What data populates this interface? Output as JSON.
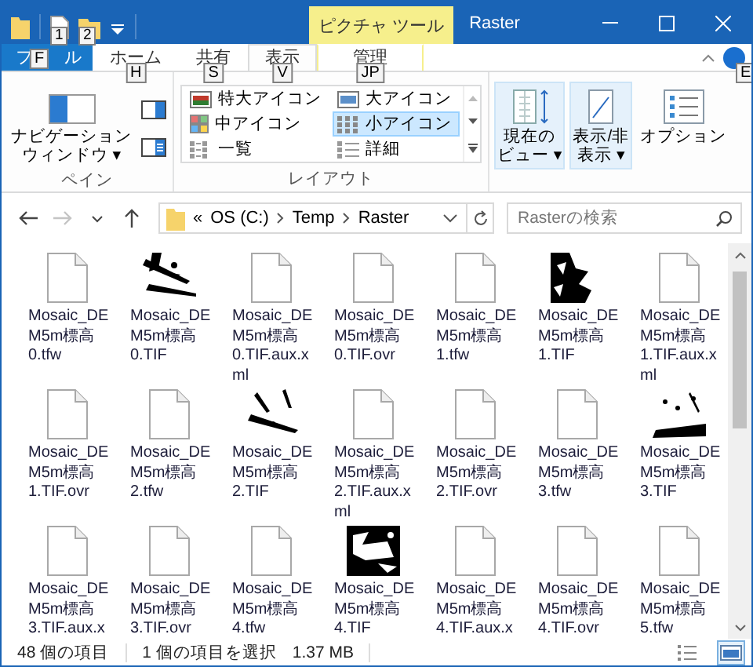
{
  "quick_access": {
    "keytips": [
      "1",
      "2"
    ]
  },
  "context_tab": {
    "label": "ピクチャ ツール"
  },
  "window": {
    "title": "Raster"
  },
  "tabs": [
    {
      "kind": "file",
      "label_start": "フ",
      "label_end": "ル",
      "keytip": "F",
      "selected": false
    },
    {
      "kind": "normal",
      "label": "ホーム",
      "keytip": "H",
      "selected": false
    },
    {
      "kind": "normal",
      "label": "共有",
      "keytip": "S",
      "selected": false
    },
    {
      "kind": "normal",
      "label": "表示",
      "keytip": "V",
      "selected": true
    },
    {
      "kind": "context",
      "label": "管理",
      "keytip": "JP",
      "selected": false
    }
  ],
  "help_keytip": "E",
  "ribbon": {
    "pane_group": {
      "label": "ペイン",
      "nav_pane_lines": [
        "ナビゲーション",
        "ウィンドウ ▾"
      ]
    },
    "layout_group": {
      "label": "レイアウト",
      "options": [
        {
          "kind": "xlarge",
          "label": "特大アイコン",
          "selected": false
        },
        {
          "kind": "large",
          "label": "大アイコン",
          "selected": false
        },
        {
          "kind": "medium",
          "label": "中アイコン",
          "selected": false
        },
        {
          "kind": "small",
          "label": "小アイコン",
          "selected": true
        },
        {
          "kind": "list",
          "label": "一覧",
          "selected": false
        },
        {
          "kind": "details",
          "label": "詳細",
          "selected": false
        }
      ]
    },
    "view_buttons": [
      {
        "kind": "current_view",
        "lines": [
          "現在の",
          "ビュー ▾"
        ],
        "highlighted": true
      },
      {
        "kind": "show_hide",
        "lines": [
          "表示/非",
          "表示 ▾"
        ],
        "highlighted": true
      },
      {
        "kind": "options",
        "lines": [
          "オプション"
        ],
        "highlighted": false
      }
    ]
  },
  "nav_buttons": [
    {
      "kind": "back",
      "disabled": false
    },
    {
      "kind": "forward",
      "disabled": true
    },
    {
      "kind": "recent",
      "disabled": false
    },
    {
      "kind": "up",
      "disabled": false
    }
  ],
  "address": {
    "overflow_mark": "«",
    "crumbs": [
      "OS (C:)",
      "Temp",
      "Raster"
    ]
  },
  "search": {
    "placeholder": "Rasterの検索"
  },
  "files": [
    {
      "kind": "document",
      "name_lines": [
        "Mosaic_DE",
        "M5m標高",
        "0.tfw"
      ]
    },
    {
      "kind": "picture",
      "name_lines": [
        "Mosaic_DE",
        "M5m標高",
        "0.TIF"
      ]
    },
    {
      "kind": "document",
      "name_lines": [
        "Mosaic_DE",
        "M5m標高",
        "0.TIF.aux.x",
        "ml"
      ]
    },
    {
      "kind": "document",
      "name_lines": [
        "Mosaic_DE",
        "M5m標高",
        "0.TIF.ovr"
      ]
    },
    {
      "kind": "document",
      "name_lines": [
        "Mosaic_DE",
        "M5m標高",
        "1.tfw"
      ]
    },
    {
      "kind": "picture",
      "name_lines": [
        "Mosaic_DE",
        "M5m標高",
        "1.TIF"
      ]
    },
    {
      "kind": "document",
      "name_lines": [
        "Mosaic_DE",
        "M5m標高",
        "1.TIF.aux.x",
        "ml"
      ]
    },
    {
      "kind": "document",
      "name_lines": [
        "Mosaic_DE",
        "M5m標高",
        "1.TIF.ovr"
      ]
    },
    {
      "kind": "document",
      "name_lines": [
        "Mosaic_DE",
        "M5m標高",
        "2.tfw"
      ]
    },
    {
      "kind": "picture",
      "name_lines": [
        "Mosaic_DE",
        "M5m標高",
        "2.TIF"
      ]
    },
    {
      "kind": "document",
      "name_lines": [
        "Mosaic_DE",
        "M5m標高",
        "2.TIF.aux.x",
        "ml"
      ]
    },
    {
      "kind": "document",
      "name_lines": [
        "Mosaic_DE",
        "M5m標高",
        "2.TIF.ovr"
      ]
    },
    {
      "kind": "document",
      "name_lines": [
        "Mosaic_DE",
        "M5m標高",
        "3.tfw"
      ]
    },
    {
      "kind": "picture",
      "name_lines": [
        "Mosaic_DE",
        "M5m標高",
        "3.TIF"
      ]
    },
    {
      "kind": "document",
      "name_lines": [
        "Mosaic_DE",
        "M5m標高",
        "3.TIF.aux.x"
      ]
    },
    {
      "kind": "document",
      "name_lines": [
        "Mosaic_DE",
        "M5m標高",
        "3.TIF.ovr"
      ]
    },
    {
      "kind": "document",
      "name_lines": [
        "Mosaic_DE",
        "M5m標高",
        "4.tfw"
      ]
    },
    {
      "kind": "picture",
      "name_lines": [
        "Mosaic_DE",
        "M5m標高",
        "4.TIF"
      ]
    },
    {
      "kind": "document",
      "name_lines": [
        "Mosaic_DE",
        "M5m標高",
        "4.TIF.aux.x"
      ]
    },
    {
      "kind": "document",
      "name_lines": [
        "Mosaic_DE",
        "M5m標高",
        "4.TIF.ovr"
      ]
    },
    {
      "kind": "document",
      "name_lines": [
        "Mosaic_DE",
        "M5m標高",
        "5.tfw"
      ]
    }
  ],
  "status_bar": {
    "item_count": "48 個の項目",
    "selection": "1 個の項目を選択",
    "size": "1.37 MB",
    "views": [
      {
        "kind": "details",
        "selected": false
      },
      {
        "kind": "large_icons",
        "selected": true
      }
    ]
  }
}
